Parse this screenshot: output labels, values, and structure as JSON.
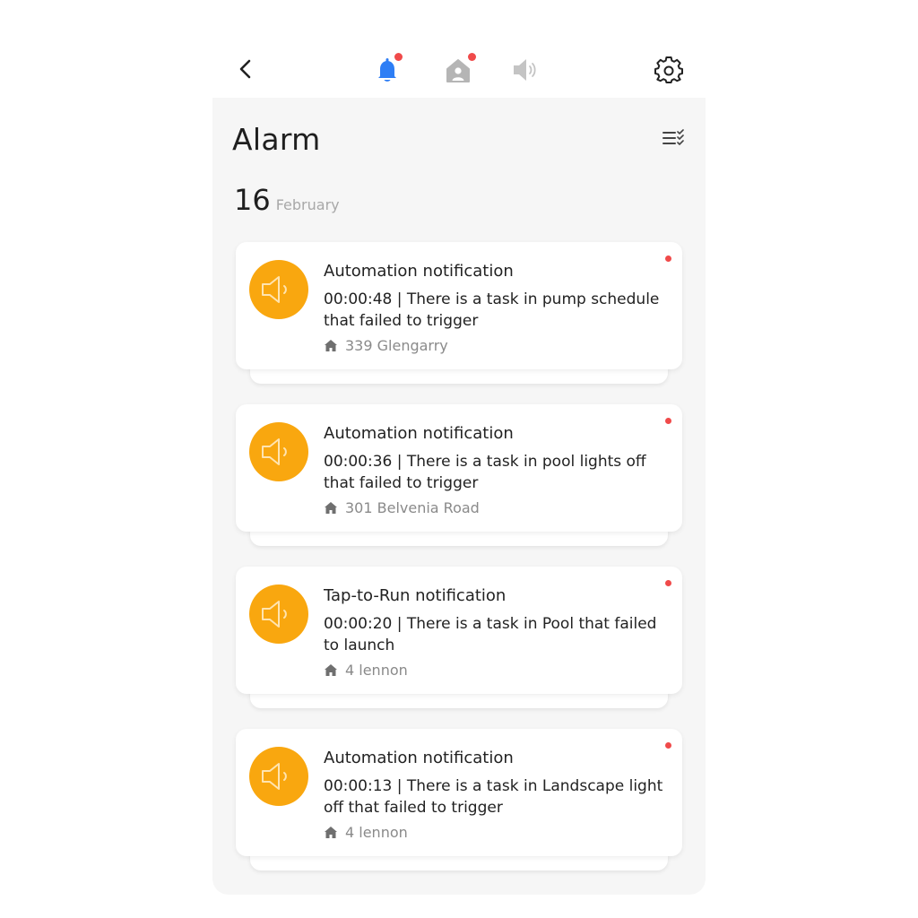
{
  "header": {
    "tabs": [
      {
        "icon": "bell-icon",
        "active": true,
        "has_badge": true,
        "color": "#2e7ef5"
      },
      {
        "icon": "home-person-icon",
        "active": false,
        "has_badge": true,
        "color": "#b5b5b5"
      },
      {
        "icon": "speaker-icon",
        "active": false,
        "has_badge": false,
        "color": "#c4c4c4"
      }
    ],
    "badge_color": "#f04a4a"
  },
  "page": {
    "title": "Alarm",
    "date_day": "16",
    "date_month": "February"
  },
  "notifications": [
    {
      "title": "Automation notification",
      "body": "00:00:48 | There is a task in pump schedule that failed to trigger",
      "location": "339 Glengarry",
      "unread": true
    },
    {
      "title": "Automation notification",
      "body": "00:00:36 | There is a task in pool lights off that failed to trigger",
      "location": "301 Belvenia Road",
      "unread": true
    },
    {
      "title": "Tap-to-Run notification",
      "body": "00:00:20 | There is a task in Pool that failed to launch",
      "location": "4 lennon",
      "unread": true
    },
    {
      "title": "Automation notification",
      "body": "00:00:13 | There is a task in Landscape light off that failed to trigger",
      "location": "4 lennon",
      "unread": true
    }
  ],
  "colors": {
    "accent_orange": "#f9a70f",
    "accent_blue": "#2e7ef5",
    "unread_dot": "#f04a4a",
    "background": "#f6f6f6"
  }
}
